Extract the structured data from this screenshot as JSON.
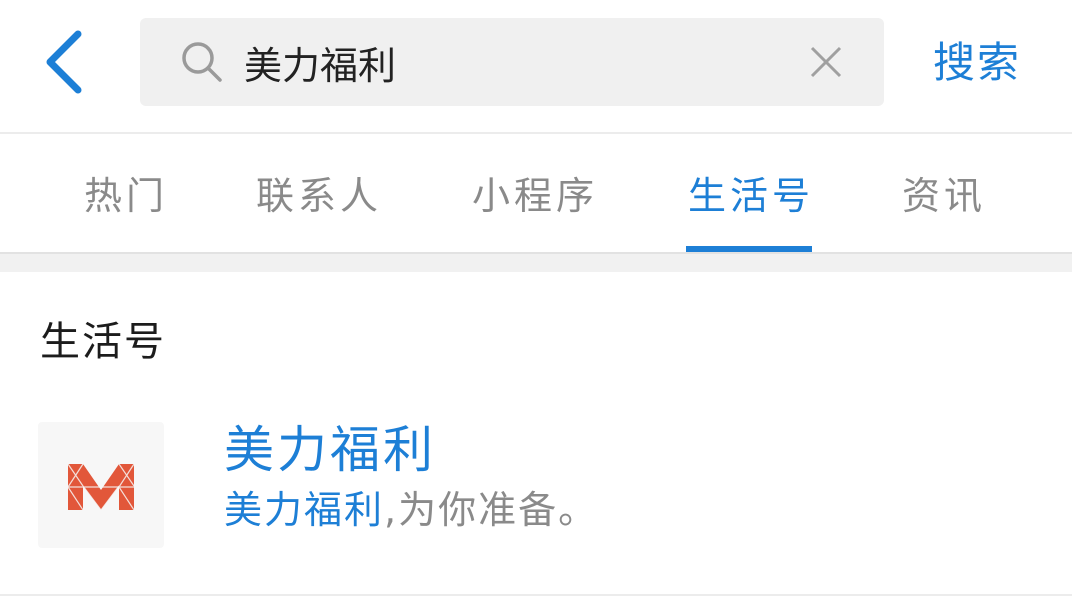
{
  "header": {
    "search_value": "美力福利",
    "search_button_label": "搜索",
    "icons": {
      "back": "back-chevron-icon",
      "search": "search-icon",
      "clear": "clear-icon"
    }
  },
  "tabs": [
    {
      "label": "热门",
      "active": false
    },
    {
      "label": "联系人",
      "active": false
    },
    {
      "label": "小程序",
      "active": false
    },
    {
      "label": "生活号",
      "active": true
    },
    {
      "label": "资讯",
      "active": false
    }
  ],
  "section": {
    "title": "生活号"
  },
  "results": [
    {
      "name": "美力福利",
      "desc_highlight": "美力福利",
      "desc_rest": ",为你准备。",
      "logo_icon": "m-logo-icon"
    }
  ],
  "colors": {
    "accent": "#1d7fd6",
    "tab_inactive": "#8a8a8a",
    "logo": "#e2573a",
    "search_bg": "#f0f0f0"
  }
}
